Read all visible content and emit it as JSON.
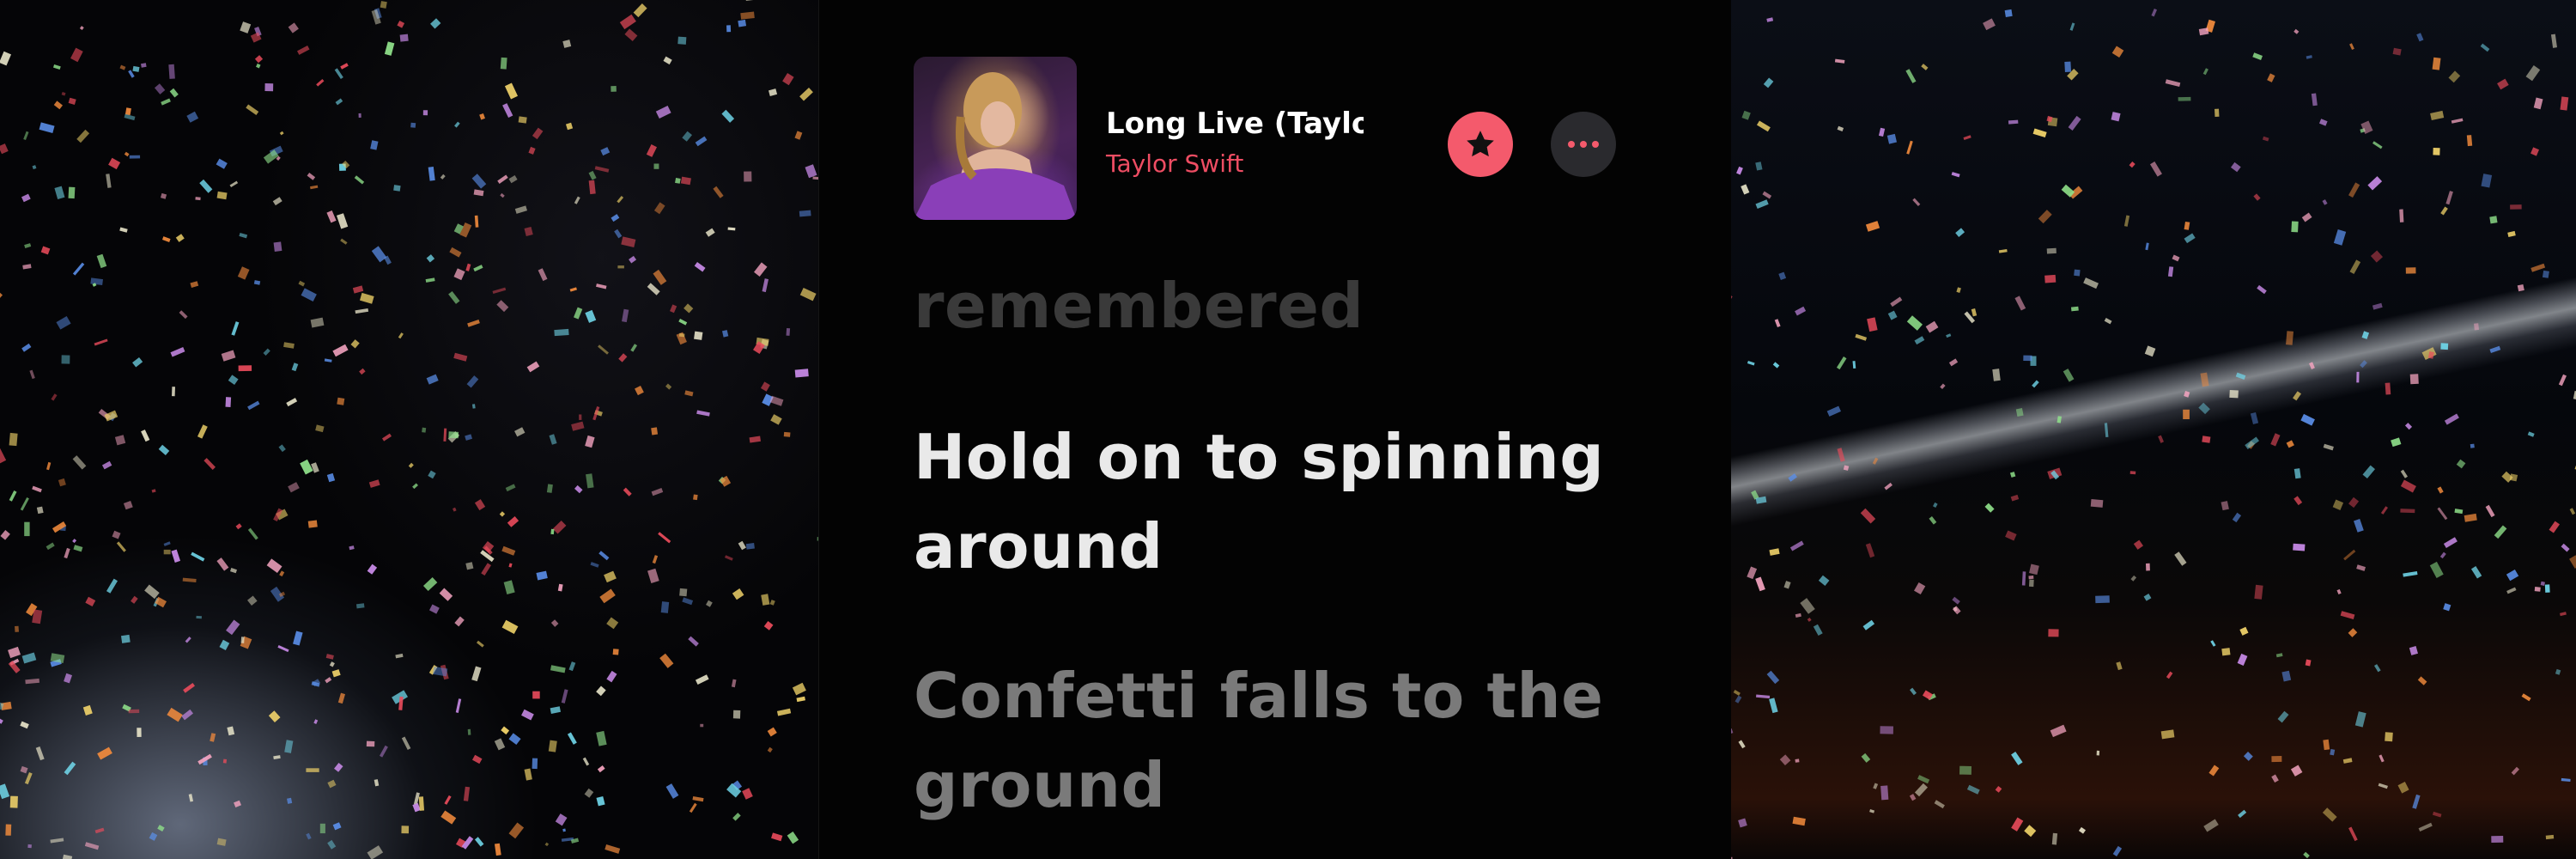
{
  "now_playing": {
    "title": "Long Live (Taylor's Version)",
    "artist": "Taylor Swift",
    "favorite_icon": "star-icon",
    "more_icon": "ellipsis-icon"
  },
  "lyrics": {
    "previous": "remembered",
    "current": "Hold on to spinning around",
    "next": "Confetti falls to the ground"
  },
  "colors": {
    "accent": "#f45a6c",
    "artist_text": "#ee4d63",
    "panel_background": "#030303"
  }
}
